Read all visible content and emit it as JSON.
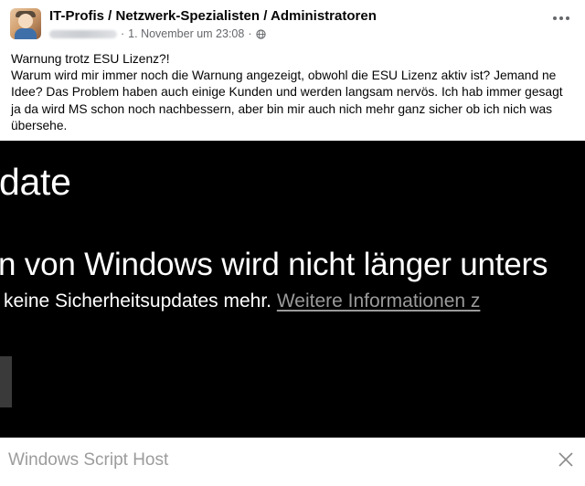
{
  "post": {
    "group_title": "IT-Profis / Netzwerk-Spezialisten / Administratoren",
    "timestamp": "1. November um 23:08",
    "separator": "·",
    "privacy_icon": "globe-icon",
    "more_icon": "more-options-icon",
    "text_title": "Warnung trotz ESU Lizenz?!",
    "text_body": "Warum wird mir immer noch die Warnung angezeigt, obwohl die ESU Lizenz aktiv ist? Jemand ne Idee? Das Problem haben auch einige Kunden und werden langsam nervös. Ich hab immer gesagt ja da wird MS schon noch nachbessern, aber bin mir auch nich mehr ganz sicher ob ich nich was übersehe."
  },
  "screenshot": {
    "heading": "date",
    "line1": "n von Windows wird nicht länger unters",
    "line2_text": " keine Sicherheitsupdates mehr. ",
    "line2_link": "Weitere Informationen z"
  },
  "dialog": {
    "title": "Windows Script Host",
    "close_icon": "close-icon"
  },
  "colors": {
    "text": "#050505",
    "meta": "#65676b",
    "screenshot_bg": "#000000",
    "screenshot_text": "#ffffff",
    "dialog_title": "#9c9c9c"
  }
}
